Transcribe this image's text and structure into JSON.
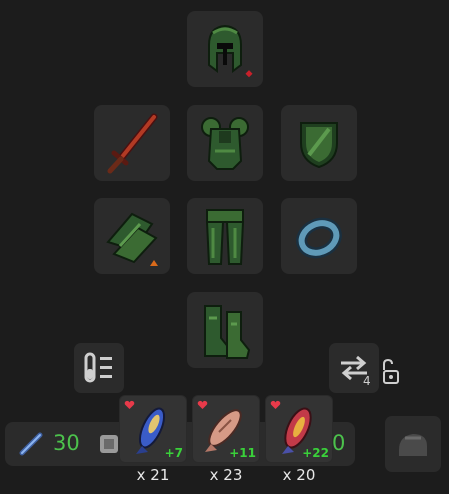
{
  "equipment": {
    "helmet": {
      "icon": "green-helmet-icon"
    },
    "weapon": {
      "icon": "red-sword-icon"
    },
    "body": {
      "icon": "green-chestplate-icon"
    },
    "shield": {
      "icon": "green-shield-icon"
    },
    "gloves": {
      "icon": "green-gloves-icon"
    },
    "legs": {
      "icon": "green-legs-icon"
    },
    "ring": {
      "icon": "blue-ring-icon"
    },
    "boots": {
      "icon": "green-boots-icon"
    }
  },
  "swap_button": {
    "count": "4"
  },
  "stats": {
    "attack": "30",
    "defense": "0"
  },
  "food": [
    {
      "bonus": "+7",
      "quantity": "x 21",
      "color": "#3a5cc8"
    },
    {
      "bonus": "+11",
      "quantity": "x 23",
      "color": "#d69a86"
    },
    {
      "bonus": "+22",
      "quantity": "x 20",
      "color": "#c23a48"
    }
  ],
  "colors": {
    "slot": "#2b2b2b",
    "bonus_text": "#3ad13a",
    "stat_text": "#4cc24c",
    "background": "#1c1c1c"
  }
}
